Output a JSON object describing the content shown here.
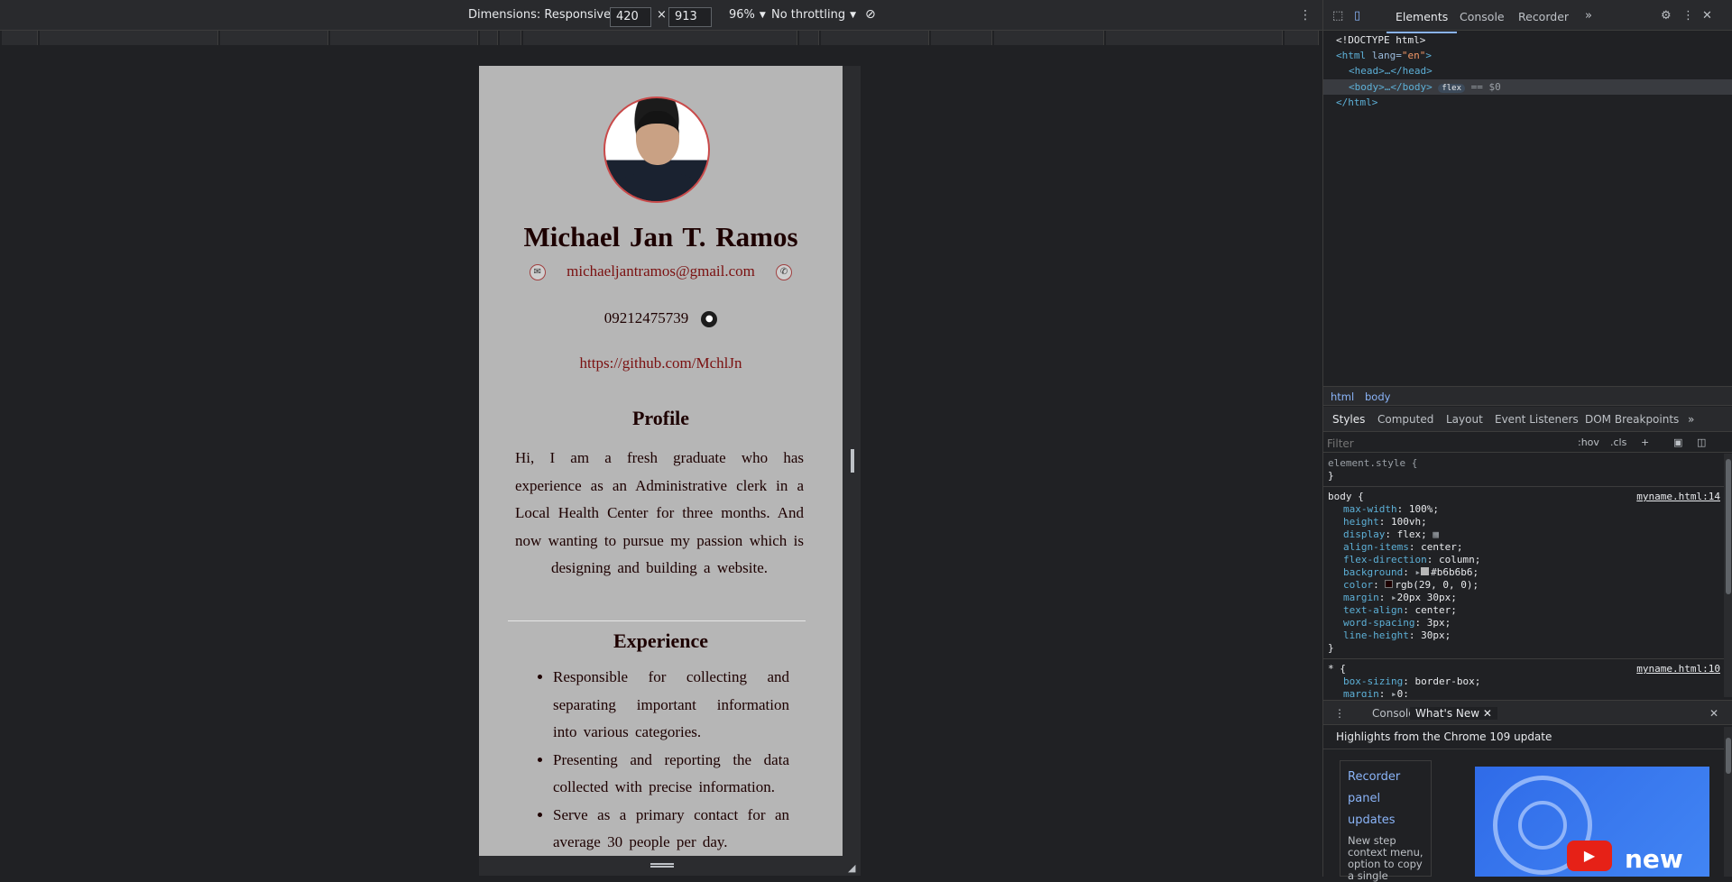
{
  "toolbar": {
    "dimensions_label": "Dimensions: Responsive",
    "width_value": "420",
    "times": "×",
    "height_value": "913",
    "zoom": "96%",
    "throttle": "No throttling"
  },
  "page": {
    "name": "Michael Jan T. Ramos",
    "email": "michaeljantramos@gmail.com",
    "phone": "09212475739",
    "github_url": "https://github.com/MchlJn",
    "profile_heading": "Profile",
    "profile_text": "Hi, I am a fresh graduate who has experience as an Administrative clerk in a Local Health Center for three months. And now wanting to pursue my passion which is designing and building a website.",
    "experience_heading": "Experience",
    "experience_items": [
      "Responsible for collecting and separating important information into various categories.",
      "Presenting and reporting the data collected with precise information.",
      "Serve as a primary contact for an average 30 people per day."
    ]
  },
  "devtools": {
    "tabs": [
      "Elements",
      "Console",
      "Recorder"
    ],
    "active_tab": "Elements",
    "dom": {
      "doctype": "<!DOCTYPE html>",
      "html_open_tag": "<html",
      "html_attr": " lang=",
      "html_attr_val": "\"en\"",
      "html_close_bracket": ">",
      "head": "<head>…</head>",
      "body": "<body>…</body>",
      "body_badge": "flex",
      "body_ref": "== $0",
      "html_close": "</html>"
    },
    "breadcrumb": [
      "html",
      "body"
    ],
    "sub_tabs": [
      "Styles",
      "Computed",
      "Layout",
      "Event Listeners",
      "DOM Breakpoints"
    ],
    "filter_placeholder": "Filter",
    "filter_opts": [
      ":hov",
      ".cls",
      "+"
    ],
    "element_style": "element.style {",
    "close_brace": "}",
    "body_rule": {
      "selector": "body {",
      "source": "myname.html:14",
      "decls": [
        [
          "max-width",
          "100%;"
        ],
        [
          "height",
          "100vh;"
        ],
        [
          "display",
          "flex;"
        ],
        [
          "align-items",
          "center;"
        ],
        [
          "flex-direction",
          "column;"
        ],
        [
          "background",
          "#b6b6b6;"
        ],
        [
          "color",
          "rgb(29, 0, 0);"
        ],
        [
          "margin",
          "20px 30px;"
        ],
        [
          "text-align",
          "center;"
        ],
        [
          "word-spacing",
          "3px;"
        ],
        [
          "line-height",
          "30px;"
        ]
      ]
    },
    "star_rule": {
      "selector": "* {",
      "source": "myname.html:10",
      "decls": [
        [
          "box-sizing",
          "border-box;"
        ],
        [
          "margin",
          "0;"
        ]
      ]
    },
    "drawer_tabs": [
      "Console",
      "What's New"
    ],
    "whats_new_title": "Highlights from the Chrome 109 update",
    "card_link": [
      "Recorder",
      "panel",
      "updates"
    ],
    "card_desc": "New step context menu, option to copy a single",
    "video_text": "new"
  }
}
